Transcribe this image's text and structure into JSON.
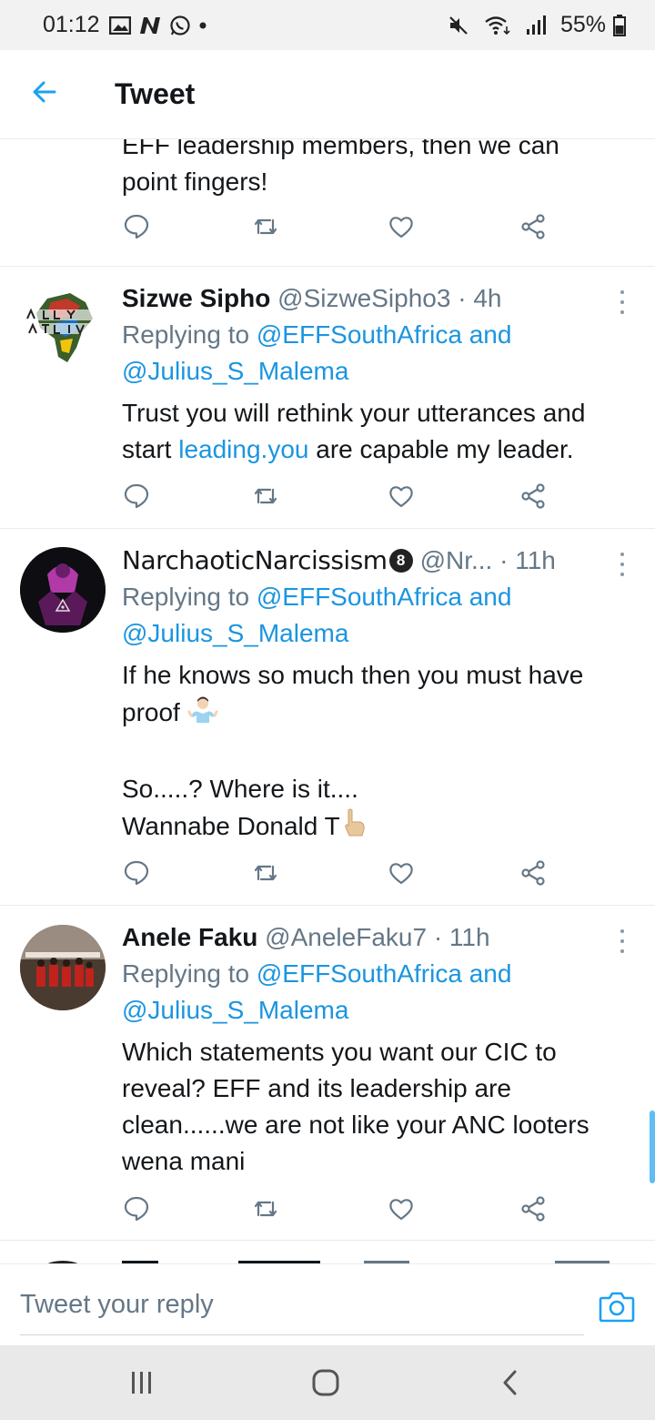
{
  "status_bar": {
    "time": "01:12",
    "battery": "55%",
    "left_icons": [
      "gallery-icon",
      "n-app-icon",
      "whatsapp-icon",
      "dot-icon"
    ],
    "right_icons": [
      "mute-icon",
      "wifi-icon",
      "signal-icon",
      "battery-icon"
    ]
  },
  "header": {
    "title": "Tweet",
    "back_icon": "back-arrow-icon"
  },
  "tweets": [
    {
      "text_lines": "EFF leadership members, then we can\npoint fingers!"
    },
    {
      "name": "Sizwe Sipho",
      "handle": "@SizweSipho3",
      "time": "· 4h",
      "reply_prefix": "Replying to ",
      "reply_to_1": "@EFFSouthAfrica",
      "reply_and": " and",
      "reply_to_2": "@Julius_S_Malema",
      "text_part1": "Trust you will rethink your utterances and\nstart ",
      "text_link": "leading.you",
      "text_part2": " are capable my leader."
    },
    {
      "name": "NarchaoticNarcissism",
      "badge": "8",
      "handle": "@Nr...",
      "time": "· 11h",
      "reply_prefix": "Replying to ",
      "reply_to_1": "@EFFSouthAfrica",
      "reply_and": " and",
      "reply_to_2": "@Julius_S_Malema",
      "text_part1": "If he knows so much then you must have\nproof ",
      "text_part2": "\n\nSo.....? Where is it....\nWannabe Donald T"
    },
    {
      "name": "Anele Faku",
      "handle": "@AneleFaku7",
      "time": "· 11h",
      "reply_prefix": "Replying to ",
      "reply_to_1": "@EFFSouthAfrica",
      "reply_and": " and",
      "reply_to_2": "@Julius_S_Malema",
      "text": "Which statements you want our CIC to\nreveal? EFF and its leadership are\nclean......we are not like your ANC looters\nwena mani"
    }
  ],
  "action_icons": [
    "reply-icon",
    "retweet-icon",
    "like-icon",
    "share-icon"
  ],
  "reply_bar": {
    "placeholder": "Tweet your reply",
    "camera_icon": "camera-icon"
  },
  "nav": [
    "recents-icon",
    "home-icon",
    "back-icon"
  ],
  "colors": {
    "accent": "#1da1f2",
    "link": "#1b95e0",
    "secondary_text": "#657786",
    "primary_text": "#14171a"
  }
}
